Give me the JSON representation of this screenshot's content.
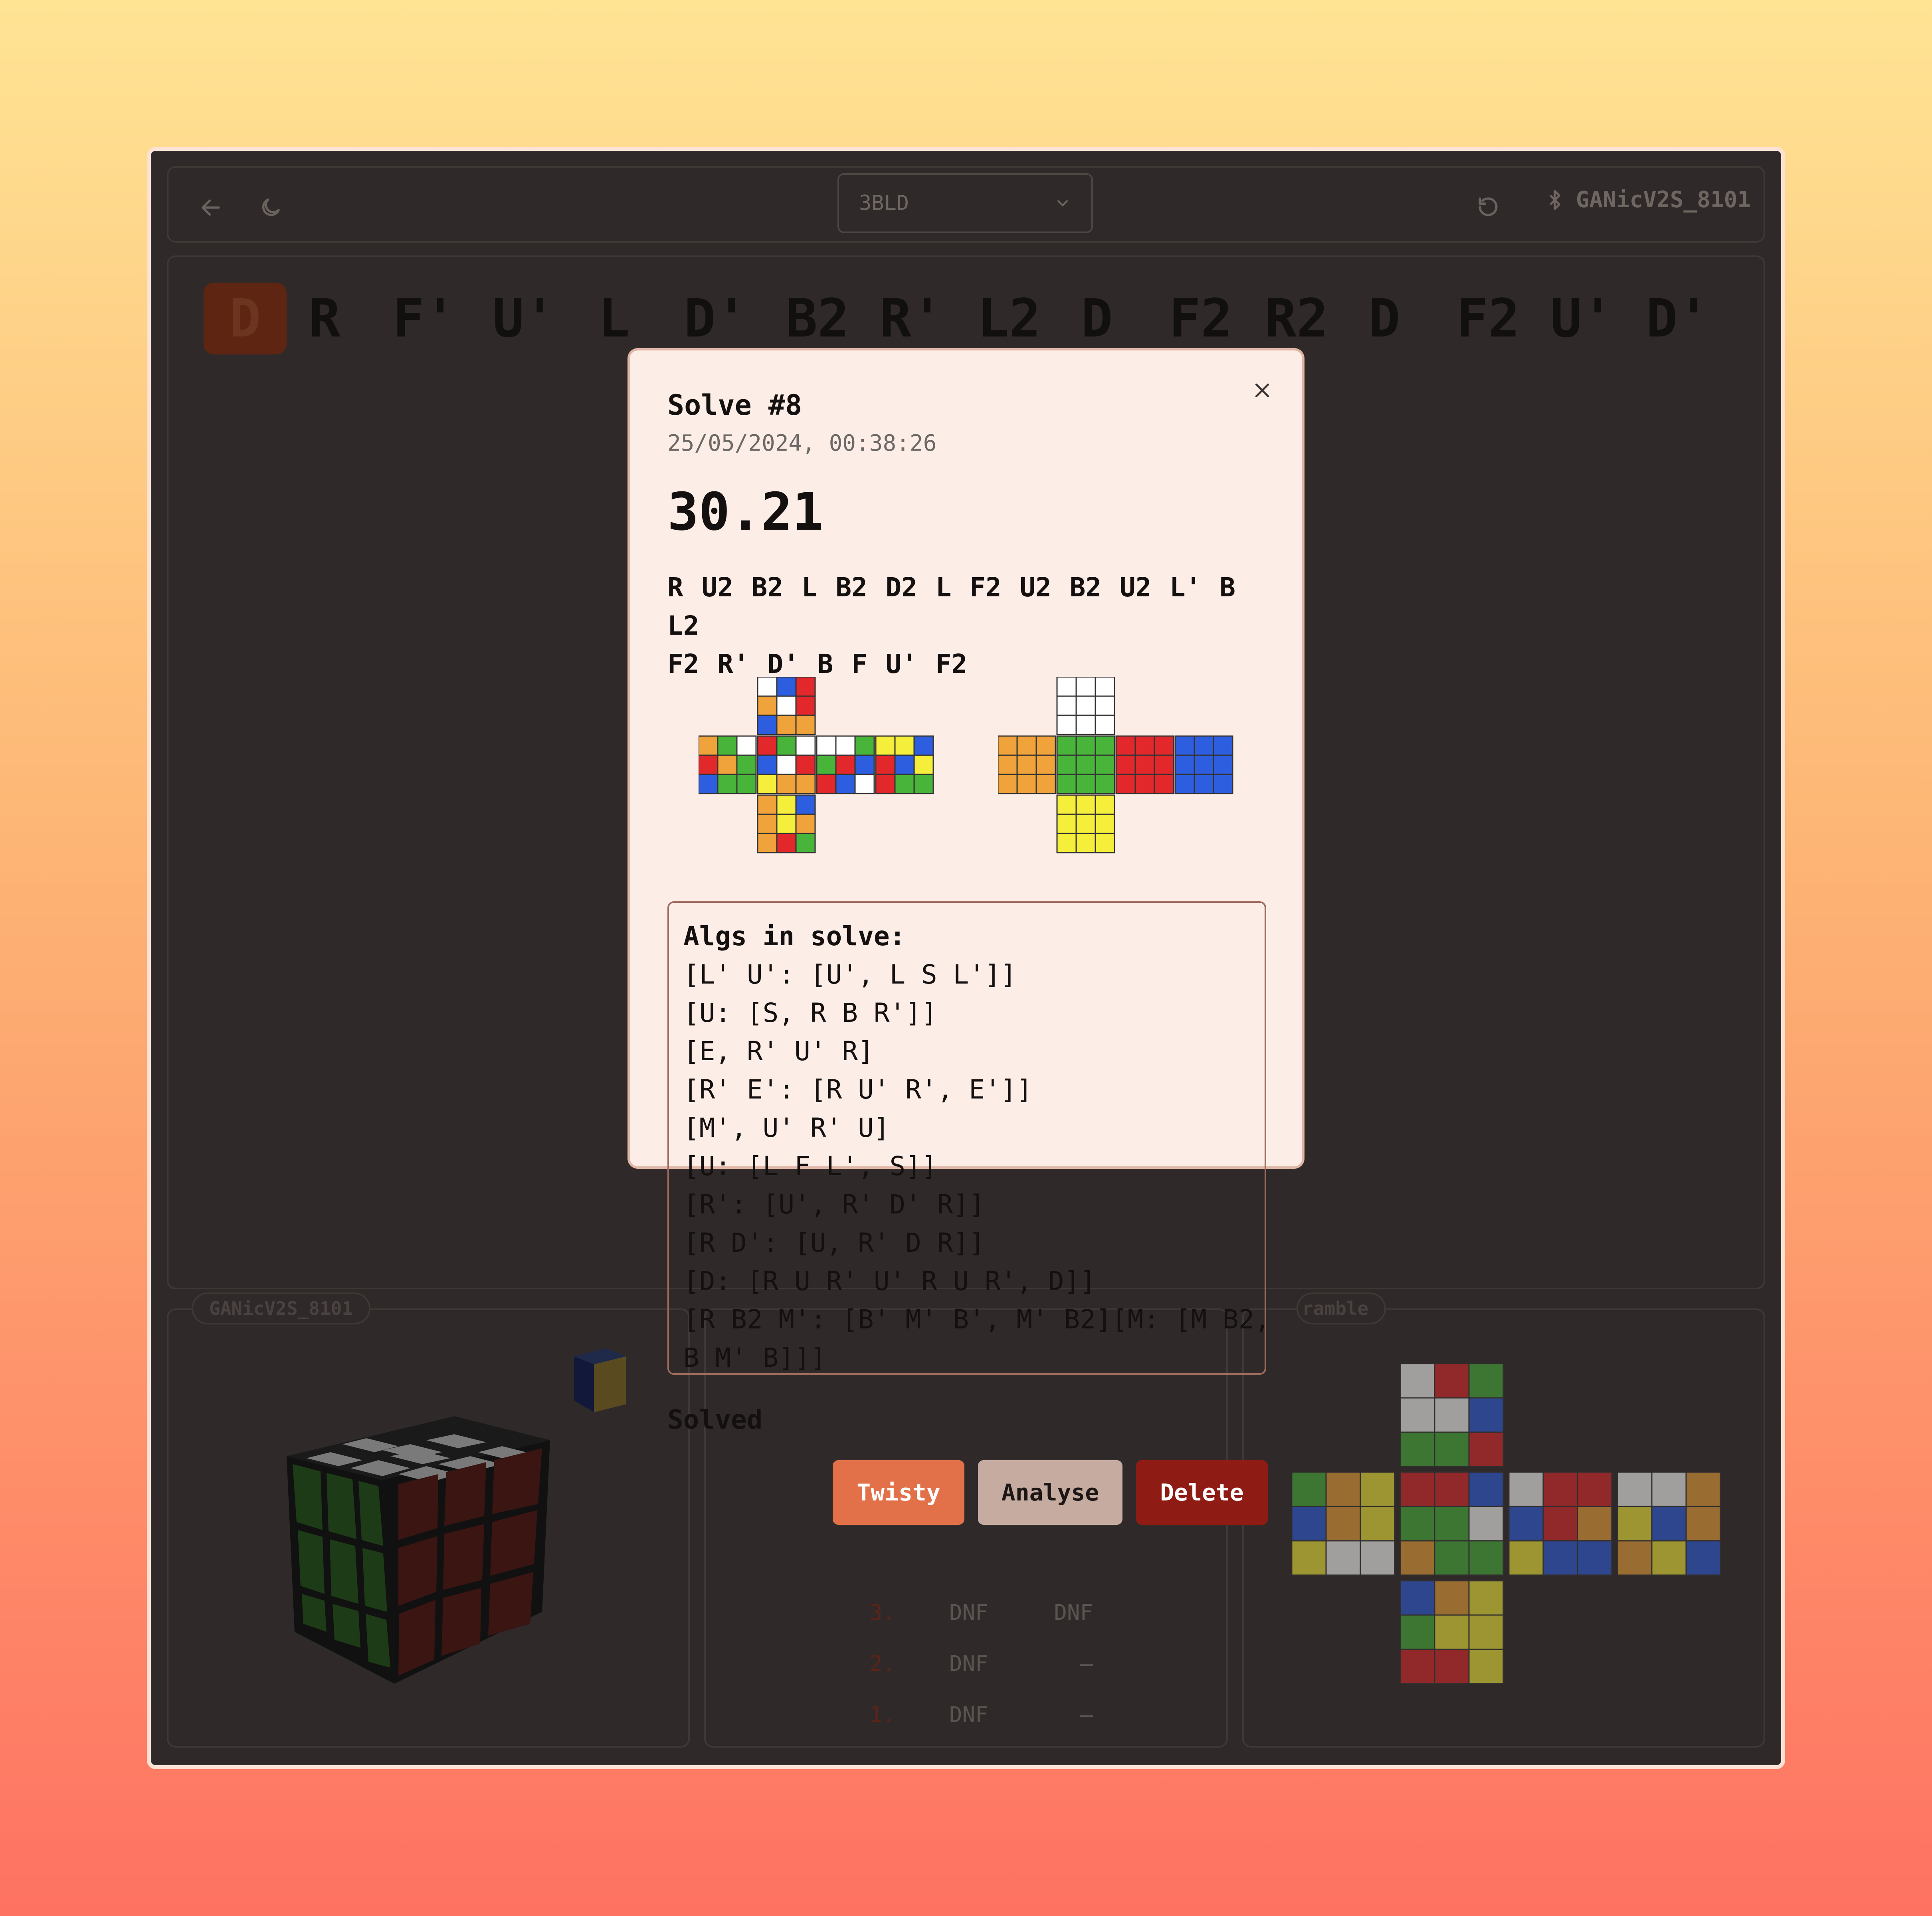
{
  "app": {
    "puzzle_select": "3BLD",
    "device_name": "GANicV2S_8101"
  },
  "scramble_moves": [
    "D",
    "R",
    "F'",
    "U'",
    "L",
    "D'",
    "B2",
    "R'",
    "L2",
    "D",
    "F2",
    "R2",
    "D",
    "F2",
    "U'",
    "D'"
  ],
  "current_move_index": 0,
  "device_tag": "GANicV2S_8101",
  "scramble_tag": "ramble",
  "times": [
    {
      "index": "3.",
      "a": "DNF",
      "b": "DNF"
    },
    {
      "index": "2.",
      "a": "DNF",
      "b": "–"
    },
    {
      "index": "1.",
      "a": "DNF",
      "b": "–"
    }
  ],
  "modal": {
    "title": "Solve #8",
    "date": "25/05/2024, 00:38:26",
    "time": "30.21",
    "scramble_line1": "R U2 B2 L B2 D2 L F2 U2 B2 U2 L' B L2",
    "scramble_line2": "F2 R' D' B F U' F2",
    "algs_header": "Algs in solve:",
    "algs": [
      "[L' U': [U', L S L']]",
      "[U: [S, R B R']]",
      "[E, R' U' R]",
      "[R' E': [R U' R', E']]",
      "[M', U' R' U]",
      "[U: [L F L', S]]",
      "[R': [U', R' D' R]]",
      "[R D': [U, R' D R]]",
      "[D: [R U R' U' R U R', D]]",
      "[R B2 M': [B' M' B', M' B2][M: [M B2,",
      "B M' B]]]"
    ],
    "status": "Solved",
    "buttons": {
      "twisty": "Twisty",
      "analyse": "Analyse",
      "delete": "Delete"
    }
  },
  "colors": {
    "accent": "#e27149",
    "delete": "#8e1b14",
    "analyse": "#c6aba0",
    "modal_bg": "#fcede7",
    "W": "#ffffff",
    "Y": "#f5ee3a",
    "R": "#e2282a",
    "O": "#f0a33a",
    "G": "#48b53a",
    "B": "#2e5ee0"
  },
  "scrambled_cube": {
    "U": [
      "W",
      "B",
      "R",
      "O",
      "W",
      "R",
      "B",
      "O",
      "O"
    ],
    "L": [
      "O",
      "G",
      "W",
      "R",
      "O",
      "G",
      "B",
      "G",
      "G"
    ],
    "F": [
      "R",
      "G",
      "W",
      "B",
      "W",
      "R",
      "Y",
      "O",
      "O"
    ],
    "R": [
      "W",
      "W",
      "G",
      "G",
      "R",
      "B",
      "R",
      "B",
      "W"
    ],
    "B": [
      "Y",
      "Y",
      "B",
      "R",
      "B",
      "Y",
      "R",
      "G",
      "G"
    ],
    "D": [
      "O",
      "Y",
      "B",
      "O",
      "Y",
      "O",
      "O",
      "R",
      "G"
    ]
  },
  "solved_cube": {
    "U": [
      "W",
      "W",
      "W",
      "W",
      "W",
      "W",
      "W",
      "W",
      "W"
    ],
    "L": [
      "O",
      "O",
      "O",
      "O",
      "O",
      "O",
      "O",
      "O",
      "O"
    ],
    "F": [
      "G",
      "G",
      "G",
      "G",
      "G",
      "G",
      "G",
      "G",
      "G"
    ],
    "R": [
      "R",
      "R",
      "R",
      "R",
      "R",
      "R",
      "R",
      "R",
      "R"
    ],
    "B": [
      "B",
      "B",
      "B",
      "B",
      "B",
      "B",
      "B",
      "B",
      "B"
    ],
    "D": [
      "Y",
      "Y",
      "Y",
      "Y",
      "Y",
      "Y",
      "Y",
      "Y",
      "Y"
    ]
  },
  "bg_scramble_cube": {
    "U": [
      "W",
      "R",
      "G",
      "W",
      "W",
      "B",
      "G",
      "G",
      "R"
    ],
    "L": [
      "G",
      "O",
      "Y",
      "B",
      "O",
      "Y",
      "Y",
      "W",
      "W"
    ],
    "F": [
      "R",
      "R",
      "B",
      "G",
      "G",
      "W",
      "O",
      "G",
      "G"
    ],
    "R": [
      "W",
      "R",
      "R",
      "B",
      "R",
      "O",
      "Y",
      "B",
      "B"
    ],
    "B": [
      "W",
      "W",
      "O",
      "Y",
      "B",
      "O",
      "O",
      "Y",
      "B"
    ],
    "D": [
      "B",
      "O",
      "Y",
      "G",
      "Y",
      "Y",
      "R",
      "R",
      "Y"
    ]
  }
}
